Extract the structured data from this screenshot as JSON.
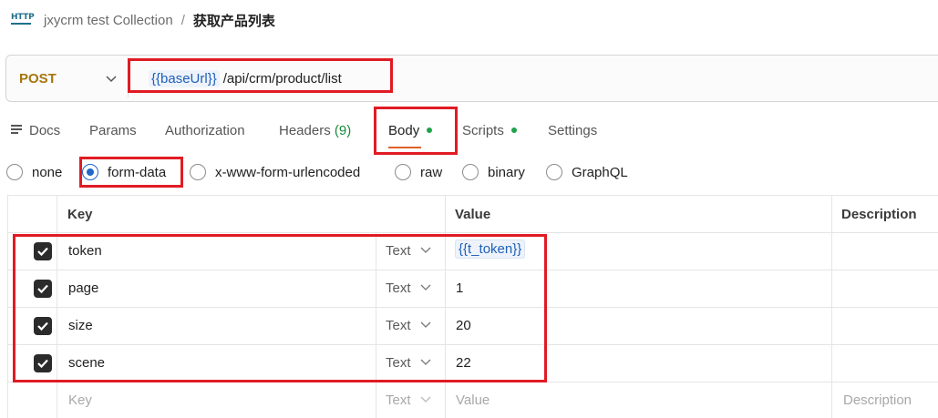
{
  "breadcrumb": {
    "icon": "http-icon",
    "collection": "jxycrm test Collection",
    "separator": "/",
    "request": "获取产品列表"
  },
  "request": {
    "method": "POST",
    "url_variable": "{{baseUrl}}",
    "url_path": "/api/crm/product/list"
  },
  "tabs": [
    {
      "label": "Docs",
      "icon": "docs-icon"
    },
    {
      "label": "Params"
    },
    {
      "label": "Authorization"
    },
    {
      "label": "Headers",
      "count": "(9)"
    },
    {
      "label": "Body",
      "active": true,
      "dot": true
    },
    {
      "label": "Scripts",
      "dot": true
    },
    {
      "label": "Settings"
    }
  ],
  "body_types": [
    {
      "label": "none",
      "selected": false
    },
    {
      "label": "form-data",
      "selected": true
    },
    {
      "label": "x-www-form-urlencoded",
      "selected": false
    },
    {
      "label": "raw",
      "selected": false
    },
    {
      "label": "binary",
      "selected": false
    },
    {
      "label": "GraphQL",
      "selected": false
    }
  ],
  "table": {
    "headers": {
      "key": "Key",
      "value": "Value",
      "description": "Description"
    },
    "rows": [
      {
        "checked": true,
        "key": "token",
        "type": "Text",
        "value": "{{t_token}}",
        "value_is_variable": true
      },
      {
        "checked": true,
        "key": "page",
        "type": "Text",
        "value": "1"
      },
      {
        "checked": true,
        "key": "size",
        "type": "Text",
        "value": "20"
      },
      {
        "checked": true,
        "key": "scene",
        "type": "Text",
        "value": "22"
      }
    ],
    "new_row": {
      "key_placeholder": "Key",
      "type": "Text",
      "value_placeholder": "Value",
      "description_placeholder": "Description"
    }
  },
  "colors": {
    "method": "#a5760e",
    "variable": "#1d5fb8",
    "active_tab_underline": "#e0622a",
    "status_dot": "#1fa34a",
    "radio_selected": "#1d68c8",
    "annotation_box": "#e01b24"
  }
}
